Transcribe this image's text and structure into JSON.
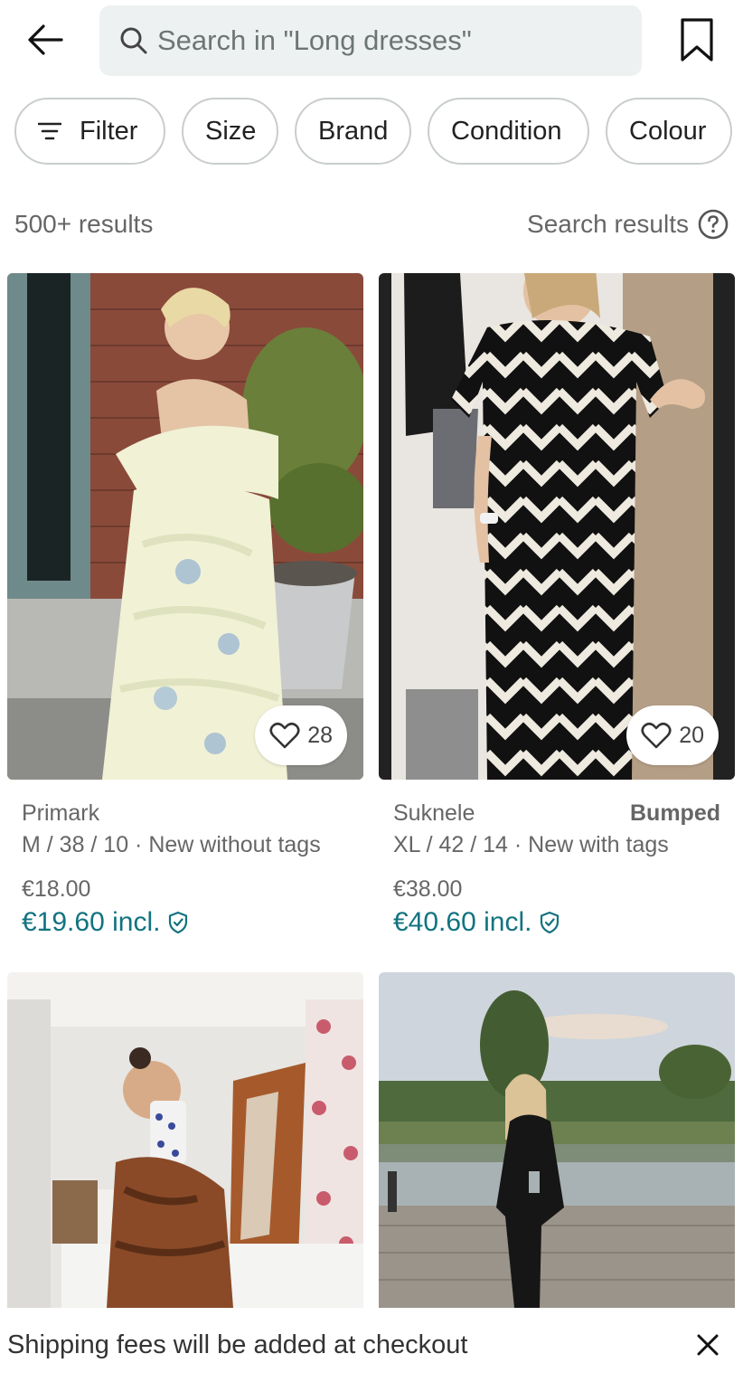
{
  "header": {
    "back_icon": "arrow-left-icon",
    "search_placeholder": "Search in \"Long dresses\"",
    "search_icon": "search-icon",
    "bookmark_icon": "bookmark-icon"
  },
  "filters": [
    {
      "label": "Filter",
      "icon": "filter-lines-icon"
    },
    {
      "label": "Size"
    },
    {
      "label": "Brand"
    },
    {
      "label": "Condition"
    },
    {
      "label": "Colour"
    }
  ],
  "results": {
    "count": "500+ results",
    "link_label": "Search results",
    "link_icon": "question-circle-icon"
  },
  "items": [
    {
      "brand": "Primark",
      "badge": "",
      "details": "M / 38 / 10 · New without tags",
      "price": "€18.00",
      "price_incl": "€19.60 incl.",
      "likes": "28",
      "photo": "blonde woman in pale floral ruffled off-shoulder maxi dress by brick wall"
    },
    {
      "brand": "Suknele",
      "badge": "Bumped",
      "details": "XL / 42 / 14 · New with tags",
      "price": "€38.00",
      "price_incl": "€40.60 incl.",
      "likes": "20",
      "photo": "woman in black and white chevron striped wrap maxi dress mirror selfie"
    },
    {
      "photo": "woman taking mirror selfie in brown floral long-sleeve dress in bedroom"
    },
    {
      "photo": "blonde woman in black cut-out maxi dress standing on lake jetty"
    }
  ],
  "banner": {
    "message": "Shipping fees will be added at checkout",
    "close_icon": "close-icon"
  },
  "colors": {
    "accent": "#127380",
    "search_bg": "#eef1f1",
    "chip_border": "#c9cdcd",
    "muted_text": "#666666"
  }
}
